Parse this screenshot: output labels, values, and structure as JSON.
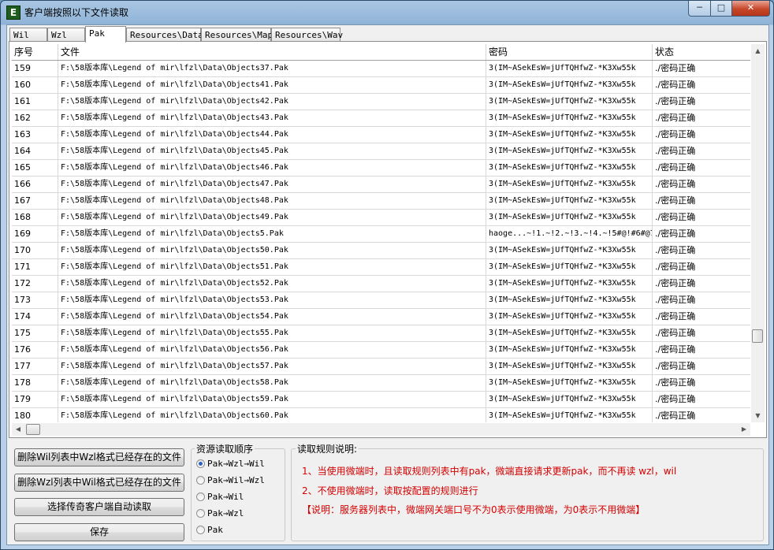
{
  "window": {
    "title": "客户端按照以下文件读取",
    "icon_letter": "E",
    "min_glyph": "─",
    "max_glyph": "□",
    "close_glyph": "✕"
  },
  "tabs": [
    {
      "label": "Wil"
    },
    {
      "label": "Wzl"
    },
    {
      "label": "Pak",
      "active": true
    },
    {
      "label": "Resources\\Data"
    },
    {
      "label": "Resources\\Map"
    },
    {
      "label": "Resources\\Wav"
    }
  ],
  "table": {
    "columns": [
      "序号",
      "文件",
      "密码",
      "状态"
    ],
    "rows": [
      [
        "159",
        "F:\\58版本库\\Legend of mir\\lfzl\\Data\\Objects37.Pak",
        "3(IM~ASekEsW=jUfTQHfwZ-*K3Xw55k",
        "./密码正确"
      ],
      [
        "160",
        "F:\\58版本库\\Legend of mir\\lfzl\\Data\\Objects41.Pak",
        "3(IM~ASekEsW=jUfTQHfwZ-*K3Xw55k",
        "./密码正确"
      ],
      [
        "161",
        "F:\\58版本库\\Legend of mir\\lfzl\\Data\\Objects42.Pak",
        "3(IM~ASekEsW=jUfTQHfwZ-*K3Xw55k",
        "./密码正确"
      ],
      [
        "162",
        "F:\\58版本库\\Legend of mir\\lfzl\\Data\\Objects43.Pak",
        "3(IM~ASekEsW=jUfTQHfwZ-*K3Xw55k",
        "./密码正确"
      ],
      [
        "163",
        "F:\\58版本库\\Legend of mir\\lfzl\\Data\\Objects44.Pak",
        "3(IM~ASekEsW=jUfTQHfwZ-*K3Xw55k",
        "./密码正确"
      ],
      [
        "164",
        "F:\\58版本库\\Legend of mir\\lfzl\\Data\\Objects45.Pak",
        "3(IM~ASekEsW=jUfTQHfwZ-*K3Xw55k",
        "./密码正确"
      ],
      [
        "165",
        "F:\\58版本库\\Legend of mir\\lfzl\\Data\\Objects46.Pak",
        "3(IM~ASekEsW=jUfTQHfwZ-*K3Xw55k",
        "./密码正确"
      ],
      [
        "166",
        "F:\\58版本库\\Legend of mir\\lfzl\\Data\\Objects47.Pak",
        "3(IM~ASekEsW=jUfTQHfwZ-*K3Xw55k",
        "./密码正确"
      ],
      [
        "167",
        "F:\\58版本库\\Legend of mir\\lfzl\\Data\\Objects48.Pak",
        "3(IM~ASekEsW=jUfTQHfwZ-*K3Xw55k",
        "./密码正确"
      ],
      [
        "168",
        "F:\\58版本库\\Legend of mir\\lfzl\\Data\\Objects49.Pak",
        "3(IM~ASekEsW=jUfTQHfwZ-*K3Xw55k",
        "./密码正确"
      ],
      [
        "169",
        "F:\\58版本库\\Legend of mir\\lfzl\\Data\\Objects5.Pak",
        "haoge...~!1.~!2.~!3.~!4.~!5#@!#6#@7",
        "./密码正确"
      ],
      [
        "170",
        "F:\\58版本库\\Legend of mir\\lfzl\\Data\\Objects50.Pak",
        "3(IM~ASekEsW=jUfTQHfwZ-*K3Xw55k",
        "./密码正确"
      ],
      [
        "171",
        "F:\\58版本库\\Legend of mir\\lfzl\\Data\\Objects51.Pak",
        "3(IM~ASekEsW=jUfTQHfwZ-*K3Xw55k",
        "./密码正确"
      ],
      [
        "172",
        "F:\\58版本库\\Legend of mir\\lfzl\\Data\\Objects52.Pak",
        "3(IM~ASekEsW=jUfTQHfwZ-*K3Xw55k",
        "./密码正确"
      ],
      [
        "173",
        "F:\\58版本库\\Legend of mir\\lfzl\\Data\\Objects53.Pak",
        "3(IM~ASekEsW=jUfTQHfwZ-*K3Xw55k",
        "./密码正确"
      ],
      [
        "174",
        "F:\\58版本库\\Legend of mir\\lfzl\\Data\\Objects54.Pak",
        "3(IM~ASekEsW=jUfTQHfwZ-*K3Xw55k",
        "./密码正确"
      ],
      [
        "175",
        "F:\\58版本库\\Legend of mir\\lfzl\\Data\\Objects55.Pak",
        "3(IM~ASekEsW=jUfTQHfwZ-*K3Xw55k",
        "./密码正确"
      ],
      [
        "176",
        "F:\\58版本库\\Legend of mir\\lfzl\\Data\\Objects56.Pak",
        "3(IM~ASekEsW=jUfTQHfwZ-*K3Xw55k",
        "./密码正确"
      ],
      [
        "177",
        "F:\\58版本库\\Legend of mir\\lfzl\\Data\\Objects57.Pak",
        "3(IM~ASekEsW=jUfTQHfwZ-*K3Xw55k",
        "./密码正确"
      ],
      [
        "178",
        "F:\\58版本库\\Legend of mir\\lfzl\\Data\\Objects58.Pak",
        "3(IM~ASekEsW=jUfTQHfwZ-*K3Xw55k",
        "./密码正确"
      ],
      [
        "179",
        "F:\\58版本库\\Legend of mir\\lfzl\\Data\\Objects59.Pak",
        "3(IM~ASekEsW=jUfTQHfwZ-*K3Xw55k",
        "./密码正确"
      ],
      [
        "180",
        "F:\\58版本库\\Legend of mir\\lfzl\\Data\\Objects60.Pak",
        "3(IM~ASekEsW=jUfTQHfwZ-*K3Xw55k",
        "./密码正确"
      ]
    ]
  },
  "scroll": {
    "up": "▲",
    "down": "▼",
    "left": "◀",
    "right": "▶",
    "vertical_position_fraction": 0.82,
    "horizontal_position_fraction": 0.0
  },
  "actions": {
    "delete_wil": "删除Wil列表中Wzl格式已经存在的文件",
    "delete_wzl": "删除Wzl列表中Wil格式已经存在的文件",
    "select_client": "选择传奇客户端自动读取",
    "save": "保存"
  },
  "resource_order": {
    "title": "资源读取顺序",
    "options": [
      {
        "label": "Pak→Wzl→Wil",
        "selected": true
      },
      {
        "label": "Pak→Wil→Wzl",
        "selected": false
      },
      {
        "label": "Pak→Wil",
        "selected": false
      },
      {
        "label": "Pak→Wzl",
        "selected": false
      },
      {
        "label": "Pak",
        "selected": false
      }
    ]
  },
  "rules": {
    "title": "读取规则说明:",
    "line1": "1、当使用微端时，且读取规则列表中有pak，微端直接请求更新pak，而不再读 wzl，wil",
    "line2": "2、不使用微端时，读取按配置的规则进行",
    "line3": "【说明：服务器列表中，微端网关端口号不为0表示使用微端，为0表示不用微端】",
    "text_color": "#d40000"
  }
}
